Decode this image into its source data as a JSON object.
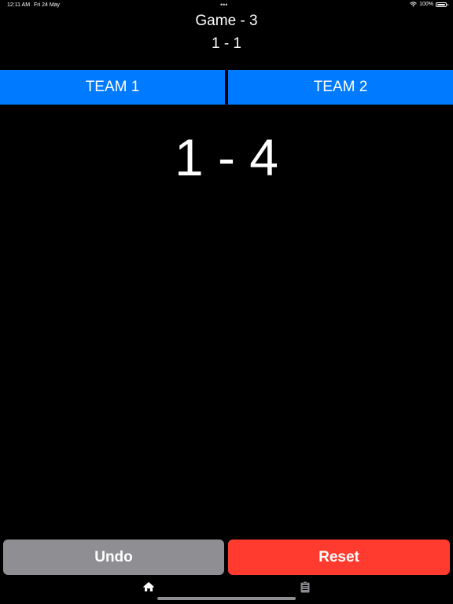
{
  "status_bar": {
    "time": "12:11 AM",
    "date": "Fri 24 May",
    "dots": "•••",
    "battery": "100%"
  },
  "game": {
    "title": "Game - 3",
    "games_score": "1 - 1",
    "point_score": "1 - 4"
  },
  "teams": {
    "team1_label": "TEAM 1",
    "team2_label": "TEAM 2"
  },
  "actions": {
    "undo_label": "Undo",
    "reset_label": "Reset"
  },
  "tabs": [
    {
      "icon": "home-icon",
      "selected": true
    },
    {
      "icon": "clipboard-icon",
      "selected": false
    }
  ],
  "colors": {
    "team_button": "#007aff",
    "undo": "#8e8e93",
    "reset": "#ff3b30",
    "background": "#000000"
  }
}
